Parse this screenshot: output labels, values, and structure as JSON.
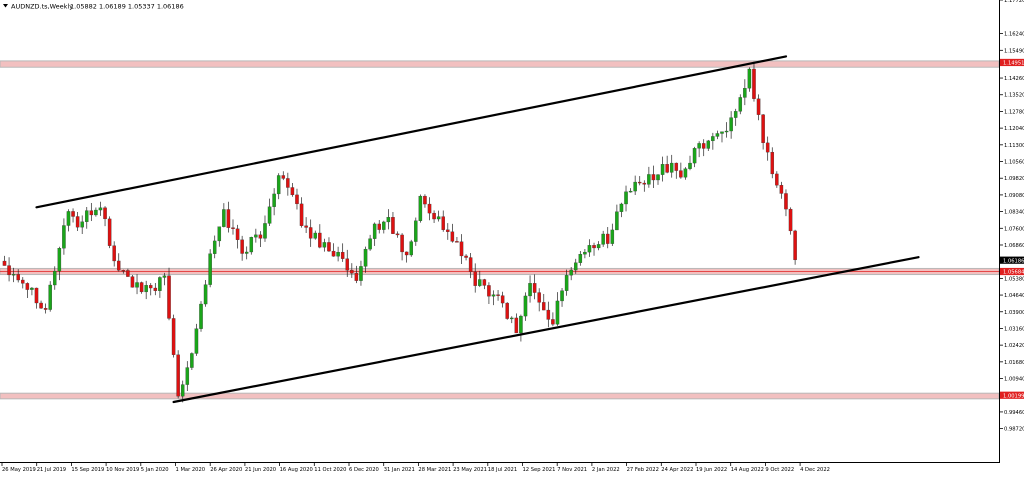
{
  "header": {
    "symbol": "AUDNZD.ts,Weekly",
    "ohlc": "1.05882 1.06189 1.05337 1.06186"
  },
  "colors": {
    "bull": "#1aa51a",
    "bear": "#dd1111",
    "wick": "#222222",
    "zone_fill": "#f2c0c0",
    "zone_line": "#b8b8b8",
    "price_line": "#e02020",
    "label_bg": "#e02020",
    "trendline": "#000000"
  },
  "chart_data": {
    "type": "candlestick",
    "title": "AUDNZD.ts,Weekly",
    "timeframe": "Weekly",
    "ylim": [
      0.9724,
      1.1772
    ],
    "y_ticks": [
      "1.17720",
      "1.16240",
      "1.15490",
      "1.14260",
      "1.13520",
      "1.12780",
      "1.12040",
      "1.11300",
      "1.10560",
      "1.09820",
      "1.09080",
      "1.08340",
      "1.07600",
      "1.06860",
      "1.06120",
      "1.05380",
      "1.04640",
      "1.03900",
      "1.03160",
      "1.02420",
      "1.01680",
      "1.00940",
      "1.00199",
      "0.99460",
      "0.98720"
    ],
    "x_tick_labels": [
      "26 May 2019",
      "21 Jul 2019",
      "15 Sep 2019",
      "10 Nov 2019",
      "5 Jan 2020",
      "1 Mar 2020",
      "26 Apr 2020",
      "21 Jun 2020",
      "16 Aug 2020",
      "11 Oct 2020",
      "6 Dec 2020",
      "31 Jan 2021",
      "28 Mar 2021",
      "23 May 2021",
      "18 Jul 2021",
      "12 Sep 2021",
      "7 Nov 2021",
      "2 Jan 2022",
      "27 Feb 2022",
      "24 Apr 2022",
      "19 Jun 2022",
      "14 Aug 2022",
      "9 Oct 2022",
      "4 Dec 2022"
    ],
    "price_labels": [
      {
        "text": "1.14951",
        "price": 1.14951
      },
      {
        "text": "1.06186",
        "price": 1.06186
      },
      {
        "text": "1.05684",
        "price": 1.05684
      },
      {
        "text": "1.00199",
        "price": 1.00199
      }
    ],
    "zones": [
      {
        "name": "resistance",
        "top": 1.1502,
        "bottom": 1.1474
      },
      {
        "name": "pivot",
        "top": 1.0582,
        "bottom": 1.0555
      },
      {
        "name": "support",
        "top": 1.0029,
        "bottom": 1.0004
      }
    ],
    "current_price": 1.05684,
    "trendlines": [
      {
        "name": "upper-channel",
        "from": {
          "week": 7,
          "price": 1.0853
        },
        "to": {
          "week": 171,
          "price": 1.1522
        }
      },
      {
        "name": "lower-channel",
        "from": {
          "week": 37,
          "price": 0.999
        },
        "to": {
          "week": 200,
          "price": 1.0632
        }
      }
    ],
    "anchors": [
      [
        0,
        1.06
      ],
      [
        4,
        1.053
      ],
      [
        9,
        1.041
      ],
      [
        14,
        1.085
      ],
      [
        16,
        1.077
      ],
      [
        21,
        1.087
      ],
      [
        24,
        1.061
      ],
      [
        30,
        1.047
      ],
      [
        35,
        1.053
      ],
      [
        38,
        1.003
      ],
      [
        41,
        1.022
      ],
      [
        45,
        1.063
      ],
      [
        48,
        1.083
      ],
      [
        52,
        1.066
      ],
      [
        57,
        1.076
      ],
      [
        60,
        1.102
      ],
      [
        66,
        1.075
      ],
      [
        70,
        1.069
      ],
      [
        73,
        1.064
      ],
      [
        77,
        1.05
      ],
      [
        80,
        1.074
      ],
      [
        84,
        1.08
      ],
      [
        88,
        1.062
      ],
      [
        91,
        1.089
      ],
      [
        95,
        1.08
      ],
      [
        99,
        1.068
      ],
      [
        103,
        1.053
      ],
      [
        108,
        1.046
      ],
      [
        112,
        1.031
      ],
      [
        115,
        1.052
      ],
      [
        117,
        1.042
      ],
      [
        120,
        1.035
      ],
      [
        124,
        1.06
      ],
      [
        128,
        1.068
      ],
      [
        132,
        1.072
      ],
      [
        136,
        1.092
      ],
      [
        140,
        1.096
      ],
      [
        144,
        1.104
      ],
      [
        148,
        1.1
      ],
      [
        152,
        1.112
      ],
      [
        156,
        1.118
      ],
      [
        160,
        1.125
      ],
      [
        163,
        1.145
      ],
      [
        165,
        1.124
      ],
      [
        168,
        1.1
      ],
      [
        170,
        1.09
      ],
      [
        172,
        1.076
      ],
      [
        173,
        1.062
      ]
    ]
  }
}
